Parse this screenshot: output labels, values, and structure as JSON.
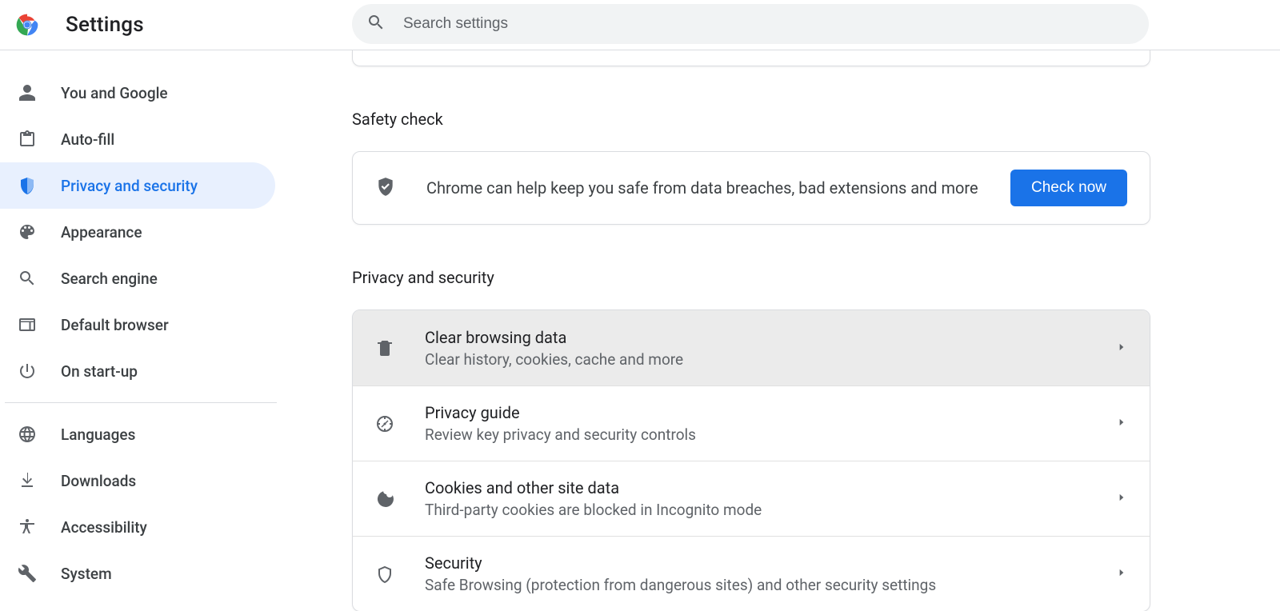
{
  "header": {
    "title": "Settings",
    "search_placeholder": "Search settings"
  },
  "sidebar": {
    "groups": [
      [
        {
          "icon": "person",
          "label": "You and Google"
        },
        {
          "icon": "clipboard",
          "label": "Auto-fill"
        },
        {
          "icon": "shield-half",
          "label": "Privacy and security",
          "active": true
        },
        {
          "icon": "palette",
          "label": "Appearance"
        },
        {
          "icon": "search",
          "label": "Search engine"
        },
        {
          "icon": "browser",
          "label": "Default browser"
        },
        {
          "icon": "power",
          "label": "On start-up"
        }
      ],
      [
        {
          "icon": "globe",
          "label": "Languages"
        },
        {
          "icon": "download",
          "label": "Downloads"
        },
        {
          "icon": "accessibility",
          "label": "Accessibility"
        },
        {
          "icon": "wrench",
          "label": "System"
        }
      ]
    ]
  },
  "main": {
    "safety_section_title": "Safety check",
    "safety_text": "Chrome can help keep you safe from data breaches, bad extensions and more",
    "safety_button": "Check now",
    "privacy_section_title": "Privacy and security",
    "rows": [
      {
        "icon": "trash",
        "title": "Clear browsing data",
        "sub": "Clear history, cookies, cache and more",
        "hover": true
      },
      {
        "icon": "compass",
        "title": "Privacy guide",
        "sub": "Review key privacy and security controls"
      },
      {
        "icon": "cookie",
        "title": "Cookies and other site data",
        "sub": "Third-party cookies are blocked in Incognito mode"
      },
      {
        "icon": "shield-outline",
        "title": "Security",
        "sub": "Safe Browsing (protection from dangerous sites) and other security settings"
      }
    ]
  }
}
